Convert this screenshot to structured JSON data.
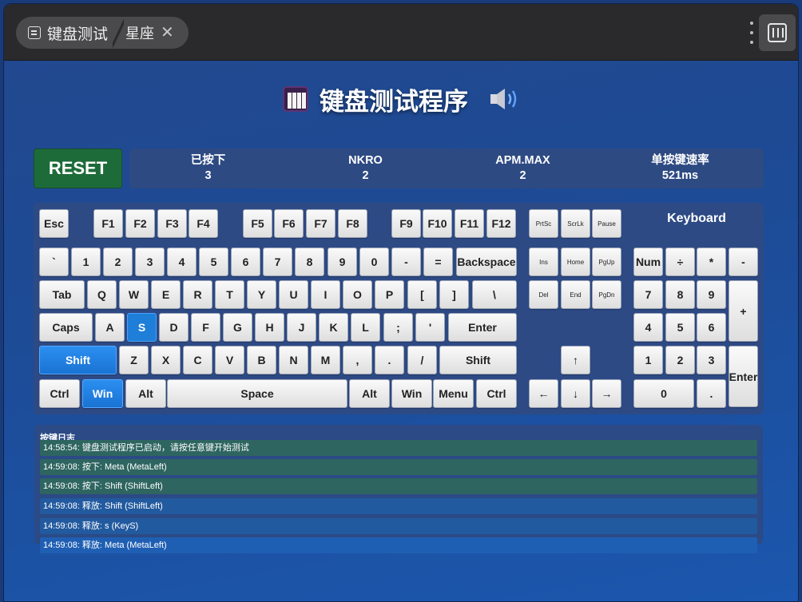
{
  "window": {
    "tab_title": "键盘测试",
    "tab_subtitle": "星座",
    "close_glyph": "✕"
  },
  "header": {
    "title": "键盘测试程序",
    "left_icon": "piano-icon",
    "right_icon": "speaker-icon"
  },
  "controls": {
    "reset_label": "RESET"
  },
  "stats": [
    {
      "label": "已按下",
      "value": "3"
    },
    {
      "label": "NKRO",
      "value": "2"
    },
    {
      "label": "APM.MAX",
      "value": "2"
    },
    {
      "label": "单按键速率",
      "value": "521ms"
    }
  ],
  "keyboard": {
    "label": "Keyboard",
    "keys": [
      {
        "id": "Escape",
        "label": "Esc"
      },
      {
        "id": "F1",
        "label": "F1"
      },
      {
        "id": "F2",
        "label": "F2"
      },
      {
        "id": "F3",
        "label": "F3"
      },
      {
        "id": "F4",
        "label": "F4"
      },
      {
        "id": "F5",
        "label": "F5"
      },
      {
        "id": "F6",
        "label": "F6"
      },
      {
        "id": "F7",
        "label": "F7"
      },
      {
        "id": "F8",
        "label": "F8"
      },
      {
        "id": "F9",
        "label": "F9"
      },
      {
        "id": "F10",
        "label": "F10"
      },
      {
        "id": "F11",
        "label": "F11"
      },
      {
        "id": "F12",
        "label": "F12"
      },
      {
        "id": "PrintScreen",
        "label": "PrtSc"
      },
      {
        "id": "ScrollLock",
        "label": "ScrLk"
      },
      {
        "id": "Pause",
        "label": "Pause"
      },
      {
        "id": "Backquote",
        "label": "`"
      },
      {
        "id": "Digit1",
        "label": "1"
      },
      {
        "id": "Digit2",
        "label": "2"
      },
      {
        "id": "Digit3",
        "label": "3"
      },
      {
        "id": "Digit4",
        "label": "4"
      },
      {
        "id": "Digit5",
        "label": "5"
      },
      {
        "id": "Digit6",
        "label": "6"
      },
      {
        "id": "Digit7",
        "label": "7"
      },
      {
        "id": "Digit8",
        "label": "8"
      },
      {
        "id": "Digit9",
        "label": "9"
      },
      {
        "id": "Digit0",
        "label": "0"
      },
      {
        "id": "Minus",
        "label": "-"
      },
      {
        "id": "Equal",
        "label": "="
      },
      {
        "id": "Backspace",
        "label": "Backspace"
      },
      {
        "id": "Insert",
        "label": "Ins"
      },
      {
        "id": "Home",
        "label": "Home"
      },
      {
        "id": "PageUp",
        "label": "PgUp"
      },
      {
        "id": "NumLock",
        "label": "Num"
      },
      {
        "id": "NumpadDivide",
        "label": "÷"
      },
      {
        "id": "NumpadMultiply",
        "label": "*"
      },
      {
        "id": "NumpadSubtract",
        "label": "-"
      },
      {
        "id": "Tab",
        "label": "Tab"
      },
      {
        "id": "KeyQ",
        "label": "Q"
      },
      {
        "id": "KeyW",
        "label": "W"
      },
      {
        "id": "KeyE",
        "label": "E"
      },
      {
        "id": "KeyR",
        "label": "R"
      },
      {
        "id": "KeyT",
        "label": "T"
      },
      {
        "id": "KeyY",
        "label": "Y"
      },
      {
        "id": "KeyU",
        "label": "U"
      },
      {
        "id": "KeyI",
        "label": "I"
      },
      {
        "id": "KeyO",
        "label": "O"
      },
      {
        "id": "KeyP",
        "label": "P"
      },
      {
        "id": "BracketLeft",
        "label": "["
      },
      {
        "id": "BracketRight",
        "label": "]"
      },
      {
        "id": "Backslash",
        "label": "\\"
      },
      {
        "id": "Delete",
        "label": "Del"
      },
      {
        "id": "End",
        "label": "End"
      },
      {
        "id": "PageDown",
        "label": "PgDn"
      },
      {
        "id": "Numpad7",
        "label": "7"
      },
      {
        "id": "Numpad8",
        "label": "8"
      },
      {
        "id": "Numpad9",
        "label": "9"
      },
      {
        "id": "NumpadAdd",
        "label": "+"
      },
      {
        "id": "CapsLock",
        "label": "Caps"
      },
      {
        "id": "KeyA",
        "label": "A"
      },
      {
        "id": "KeyS",
        "label": "S"
      },
      {
        "id": "KeyD",
        "label": "D"
      },
      {
        "id": "KeyF",
        "label": "F"
      },
      {
        "id": "KeyG",
        "label": "G"
      },
      {
        "id": "KeyH",
        "label": "H"
      },
      {
        "id": "KeyJ",
        "label": "J"
      },
      {
        "id": "KeyK",
        "label": "K"
      },
      {
        "id": "KeyL",
        "label": "L"
      },
      {
        "id": "Semicolon",
        "label": ";"
      },
      {
        "id": "Quote",
        "label": "'"
      },
      {
        "id": "Enter",
        "label": "Enter"
      },
      {
        "id": "Numpad4",
        "label": "4"
      },
      {
        "id": "Numpad5",
        "label": "5"
      },
      {
        "id": "Numpad6",
        "label": "6"
      },
      {
        "id": "ShiftLeft",
        "label": "Shift"
      },
      {
        "id": "KeyZ",
        "label": "Z"
      },
      {
        "id": "KeyX",
        "label": "X"
      },
      {
        "id": "KeyC",
        "label": "C"
      },
      {
        "id": "KeyV",
        "label": "V"
      },
      {
        "id": "KeyB",
        "label": "B"
      },
      {
        "id": "KeyN",
        "label": "N"
      },
      {
        "id": "KeyM",
        "label": "M"
      },
      {
        "id": "Comma",
        "label": ","
      },
      {
        "id": "Period",
        "label": "."
      },
      {
        "id": "Slash",
        "label": "/"
      },
      {
        "id": "ShiftRight",
        "label": "Shift"
      },
      {
        "id": "ArrowUp",
        "label": "↑"
      },
      {
        "id": "Numpad1",
        "label": "1"
      },
      {
        "id": "Numpad2",
        "label": "2"
      },
      {
        "id": "Numpad3",
        "label": "3"
      },
      {
        "id": "NumpadEnter",
        "label": "Enter"
      },
      {
        "id": "ControlLeft",
        "label": "Ctrl"
      },
      {
        "id": "MetaLeft",
        "label": "Win"
      },
      {
        "id": "AltLeft",
        "label": "Alt"
      },
      {
        "id": "Space",
        "label": "Space"
      },
      {
        "id": "AltRight",
        "label": "Alt"
      },
      {
        "id": "MetaRight",
        "label": "Win"
      },
      {
        "id": "ContextMenu",
        "label": "Menu"
      },
      {
        "id": "ControlRight",
        "label": "Ctrl"
      },
      {
        "id": "ArrowLeft",
        "label": "←"
      },
      {
        "id": "ArrowDown",
        "label": "↓"
      },
      {
        "id": "ArrowRight",
        "label": "→"
      },
      {
        "id": "Numpad0",
        "label": "0"
      },
      {
        "id": "NumpadDecimal",
        "label": "."
      }
    ],
    "pressed_keys": [
      "KeyS",
      "ShiftLeft",
      "MetaLeft"
    ]
  },
  "log": {
    "title": "按键日志",
    "entries": [
      {
        "text": "14:58:54: 键盘测试程序已启动，请按任意键开始测试",
        "kind": "info"
      },
      {
        "text": "14:59:08: 按下: Meta (MetaLeft)",
        "kind": "down"
      },
      {
        "text": "14:59:08: 按下: Shift (ShiftLeft)",
        "kind": "down"
      },
      {
        "text": "14:59:08: 释放: Shift (ShiftLeft)",
        "kind": "up"
      },
      {
        "text": "14:59:08: 释放: s (KeyS)",
        "kind": "up"
      },
      {
        "text": "14:59:08: 释放: Meta (MetaLeft)",
        "kind": "up-latest"
      }
    ]
  },
  "colors": {
    "accent_blue": "#1e7ed8",
    "reset_green": "#1e6b3a",
    "log_green": "#2e6560",
    "log_blue": "#225a9f"
  }
}
